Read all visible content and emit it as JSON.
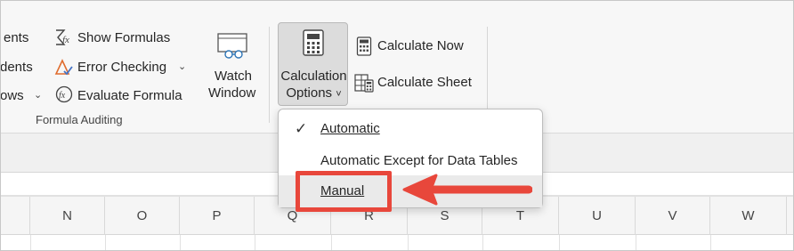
{
  "ribbon": {
    "left_items": {
      "row1_partial": "ents",
      "row2_partial": "dents",
      "row3_partial": "ows",
      "show_formulas": "Show Formulas",
      "error_checking": "Error Checking",
      "evaluate_formula": "Evaluate Formula",
      "group_label": "Formula Auditing"
    },
    "watch_window": {
      "line1": "Watch",
      "line2": "Window"
    },
    "calculation_options": {
      "line1": "Calculation",
      "line2": "Options",
      "caret": "˅"
    },
    "calculate_now": "Calculate Now",
    "calculate_sheet": "Calculate Sheet"
  },
  "menu": {
    "items": [
      {
        "label": "Automatic",
        "checked": true
      },
      {
        "label": "Automatic Except for Data Tables",
        "checked": false
      },
      {
        "label": "Manual",
        "checked": false,
        "highlighted": true
      }
    ],
    "check_glyph": "✓"
  },
  "columns": [
    "N",
    "O",
    "P",
    "Q",
    "R",
    "S",
    "T",
    "U",
    "V",
    "W"
  ],
  "colors": {
    "highlight": "#e8473b",
    "ribbon_bg": "#f7f7f7",
    "pressed_bg": "#dcdcdc"
  },
  "icons": [
    "show-formulas-icon",
    "error-checking-icon",
    "evaluate-formula-icon",
    "watch-window-icon",
    "calculator-icon",
    "calculate-now-icon",
    "calculate-sheet-icon",
    "checkmark-icon",
    "arrow-icon"
  ]
}
